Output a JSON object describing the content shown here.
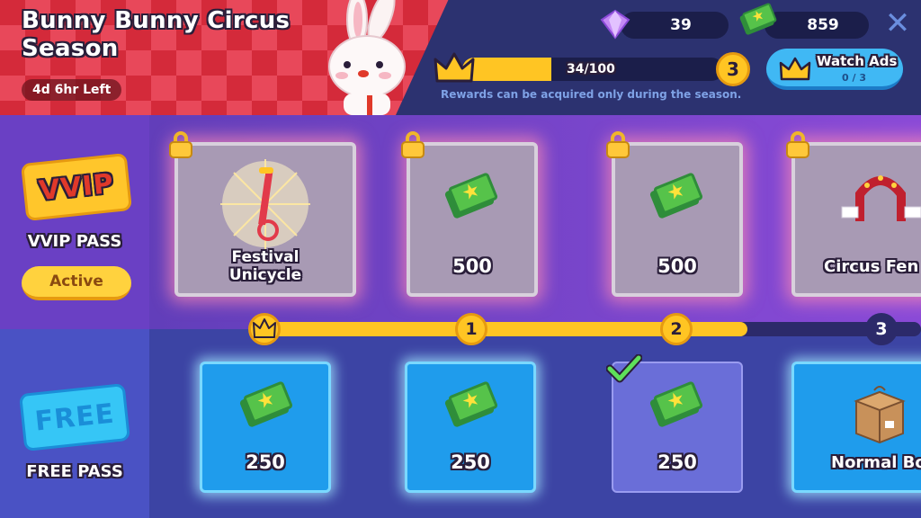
{
  "season": {
    "title": "Bunny Bunny Circus Season",
    "time_left": "4d 6hr Left"
  },
  "currency": {
    "gems": "39",
    "cash": "859"
  },
  "progress": {
    "text": "34/100",
    "fraction": 0.34,
    "level": "3",
    "note": "Rewards can be acquired only during the season."
  },
  "watch_ads": {
    "label": "Watch Ads",
    "count": "0 / 3"
  },
  "passes": {
    "vvip": {
      "ticket": "VVIP",
      "name": "VVIP PASS",
      "status": "Active"
    },
    "free": {
      "ticket": "FREE",
      "name": "FREE PASS"
    }
  },
  "vvip_rewards": [
    {
      "label": "Festival\nUnicycle",
      "icon": "unicycle-icon",
      "locked": true
    },
    {
      "label": "500",
      "icon": "cash-icon",
      "locked": true
    },
    {
      "label": "500",
      "icon": "cash-icon",
      "locked": true
    },
    {
      "label": "Circus Fen",
      "icon": "circus-fence-icon",
      "locked": true
    }
  ],
  "free_rewards": [
    {
      "label": "250",
      "icon": "cash-icon",
      "claimed": false
    },
    {
      "label": "250",
      "icon": "cash-icon",
      "claimed": false
    },
    {
      "label": "250",
      "icon": "cash-icon",
      "claimed": true
    },
    {
      "label": "Normal Bo",
      "icon": "box-icon",
      "claimed": false
    }
  ],
  "track_nodes": [
    "",
    "1",
    "2",
    "3"
  ],
  "track_fill_fraction": 0.74,
  "colors": {
    "accent": "#ffc523",
    "banner": "#d42a3a",
    "free_card": "#1f9cec"
  }
}
